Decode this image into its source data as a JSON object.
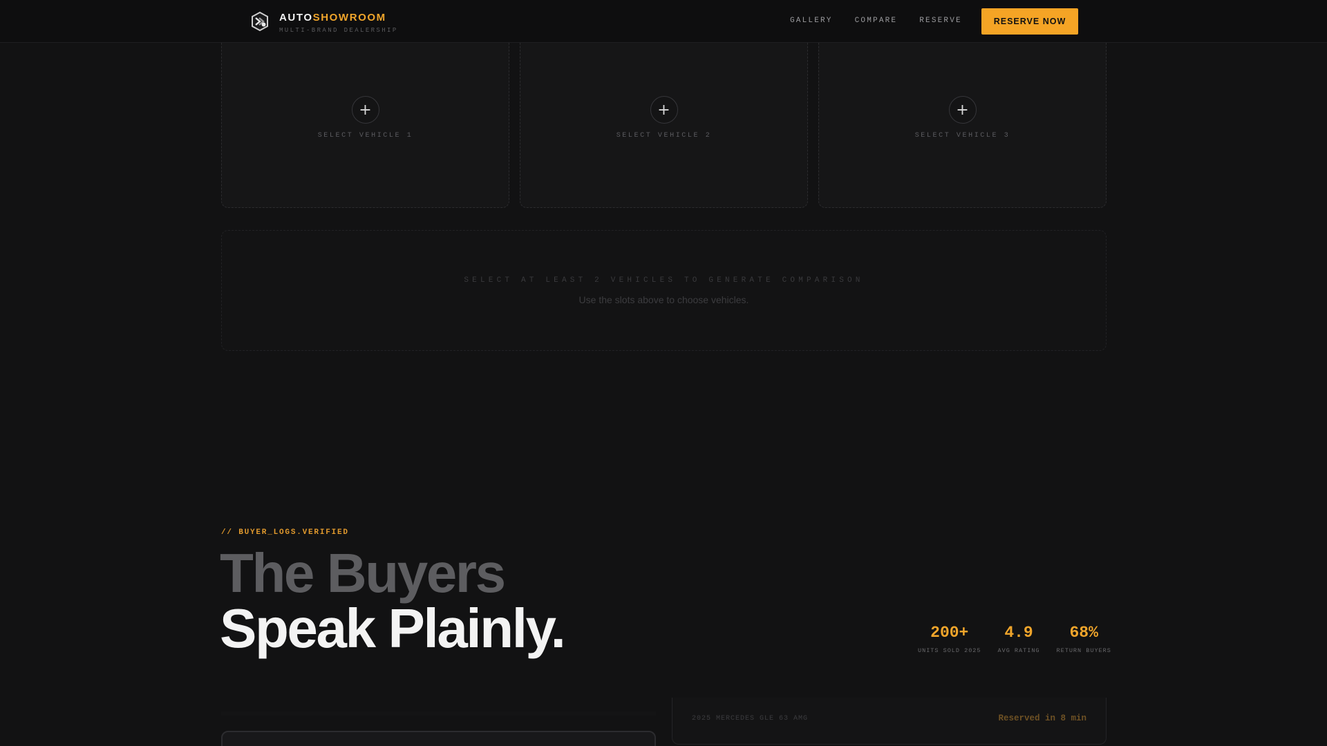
{
  "header": {
    "brand_part1": "AUTO",
    "brand_part2": "SHOWROOM",
    "brand_sub": "MULTI-BRAND DEALERSHIP",
    "nav": [
      {
        "label": "GALLERY"
      },
      {
        "label": "COMPARE"
      },
      {
        "label": "RESERVE"
      }
    ],
    "cta_label": "RESERVE NOW"
  },
  "slots": [
    {
      "label": "SELECT VEHICLE 1",
      "icon": "plus-icon"
    },
    {
      "label": "SELECT VEHICLE 2",
      "icon": "plus-icon"
    },
    {
      "label": "SELECT VEHICLE 3",
      "icon": "plus-icon"
    }
  ],
  "comparison": {
    "title": "SELECT AT LEAST 2 VEHICLES TO GENERATE COMPARISON",
    "subtitle": "Use the slots above to choose vehicles."
  },
  "buyers": {
    "tag": "// BUYER_LOGS.VERIFIED",
    "headline_line1": "The Buyers",
    "headline_line2": "Speak Plainly.",
    "stats": [
      {
        "value": "200+",
        "label": "UNITS SOLD 2025"
      },
      {
        "value": "4.9",
        "label": "AVG RATING"
      },
      {
        "value": "68%",
        "label": "RETURN BUYERS"
      }
    ]
  },
  "log_card": {
    "model": "2025 MERCEDES GLE 63 AMG",
    "status": "Reserved in 8 min"
  },
  "colors": {
    "accent": "#f5a425",
    "background": "#121213",
    "header_bg": "#0e0e0f"
  }
}
